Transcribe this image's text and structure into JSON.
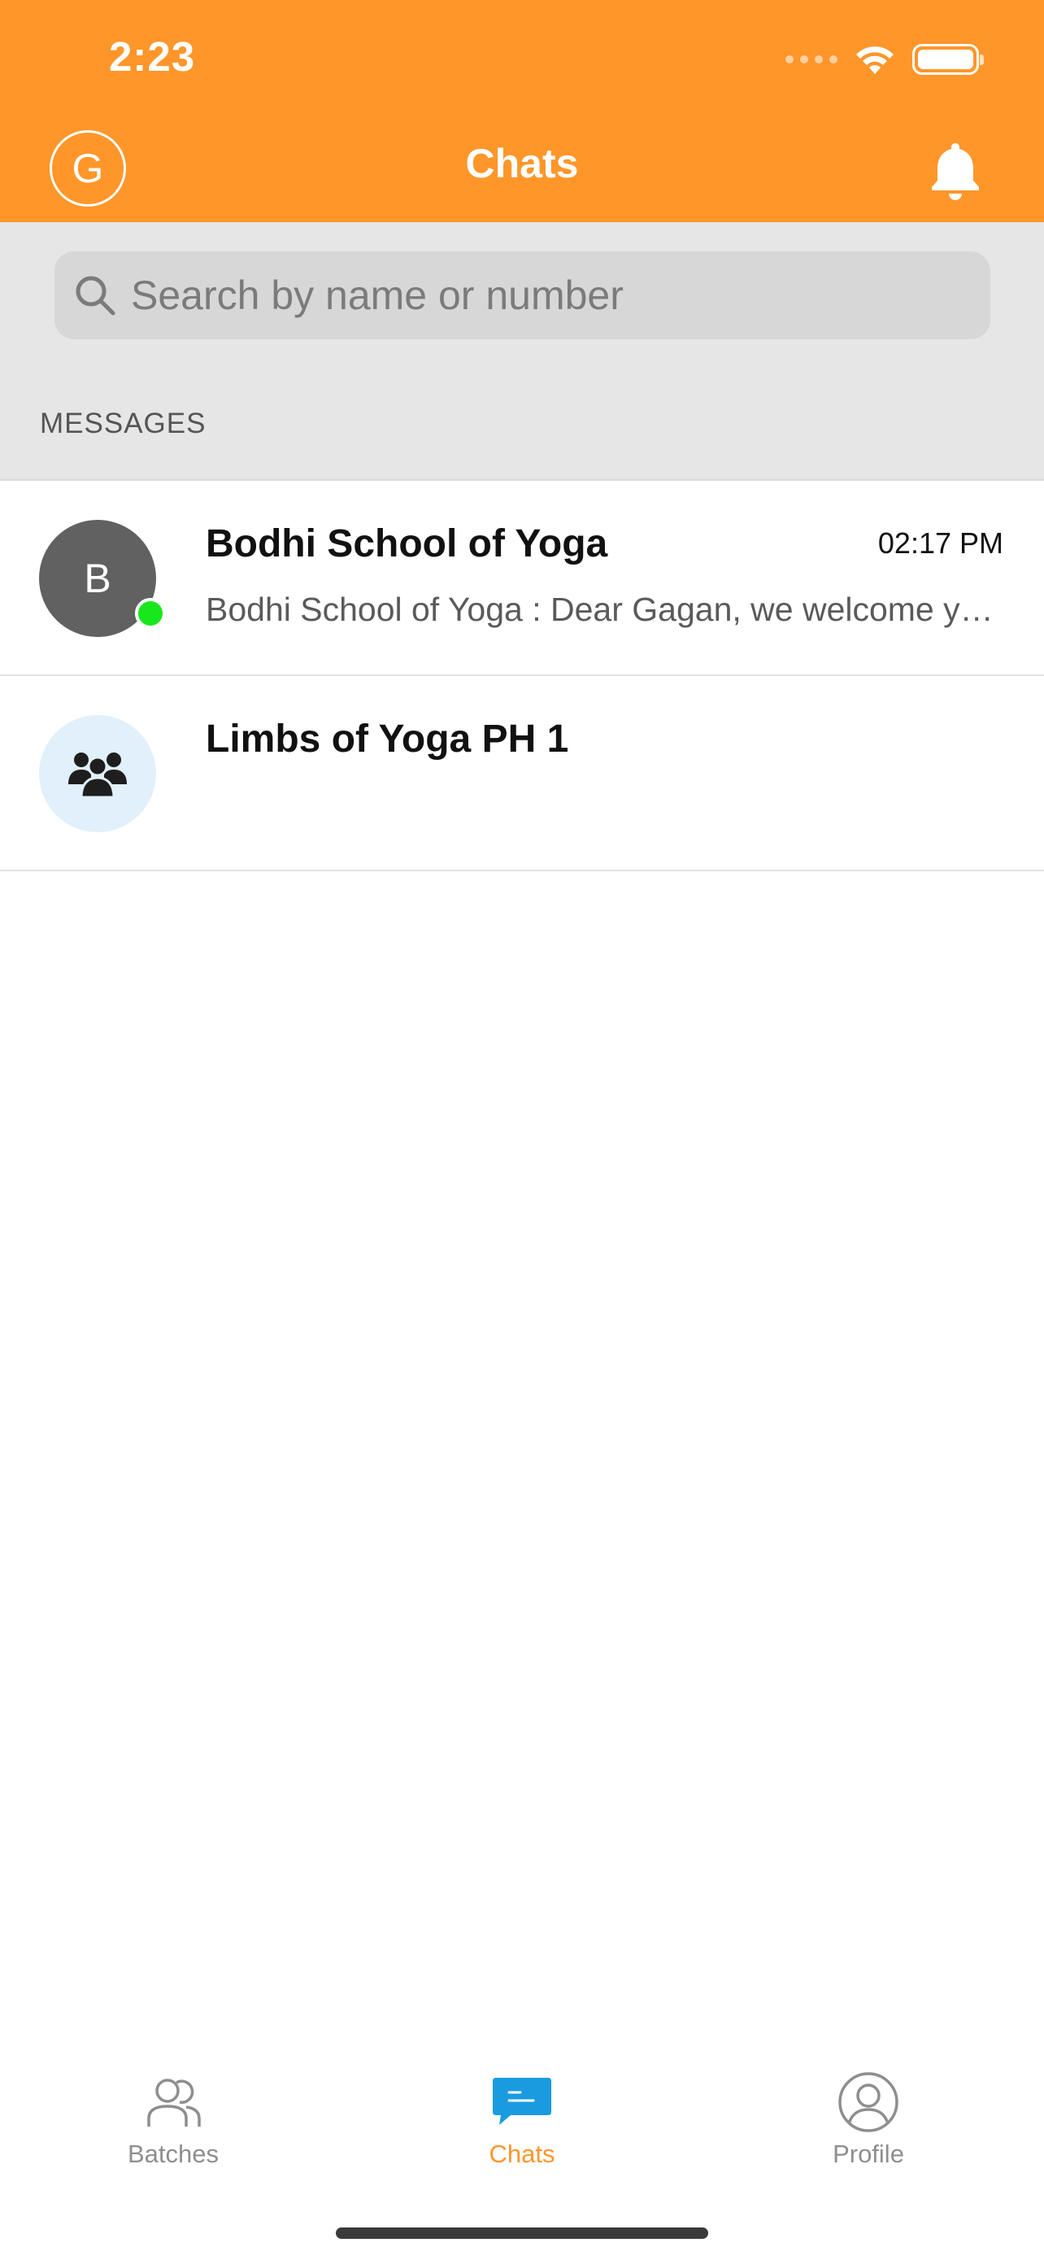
{
  "status_bar": {
    "time": "2:23"
  },
  "header": {
    "avatar_letter": "G",
    "title": "Chats",
    "accent_color": "#FF962A"
  },
  "search": {
    "placeholder": "Search by name or number"
  },
  "section": {
    "label": "MESSAGES"
  },
  "chats": [
    {
      "avatar_letter": "B",
      "name": "Bodhi School of Yoga",
      "time": "02:17 PM",
      "preview": "Bodhi School of Yoga : Dear Gagan, we welcome you to our yoga family",
      "online": true
    },
    {
      "avatar_icon": "group-icon",
      "name": "Limbs of Yoga PH 1",
      "time": "",
      "preview": ""
    }
  ],
  "tabs": [
    {
      "label": "Batches",
      "icon": "batches-icon",
      "active": false
    },
    {
      "label": "Chats",
      "icon": "chats-icon",
      "active": true
    },
    {
      "label": "Profile",
      "icon": "profile-icon",
      "active": false
    }
  ]
}
